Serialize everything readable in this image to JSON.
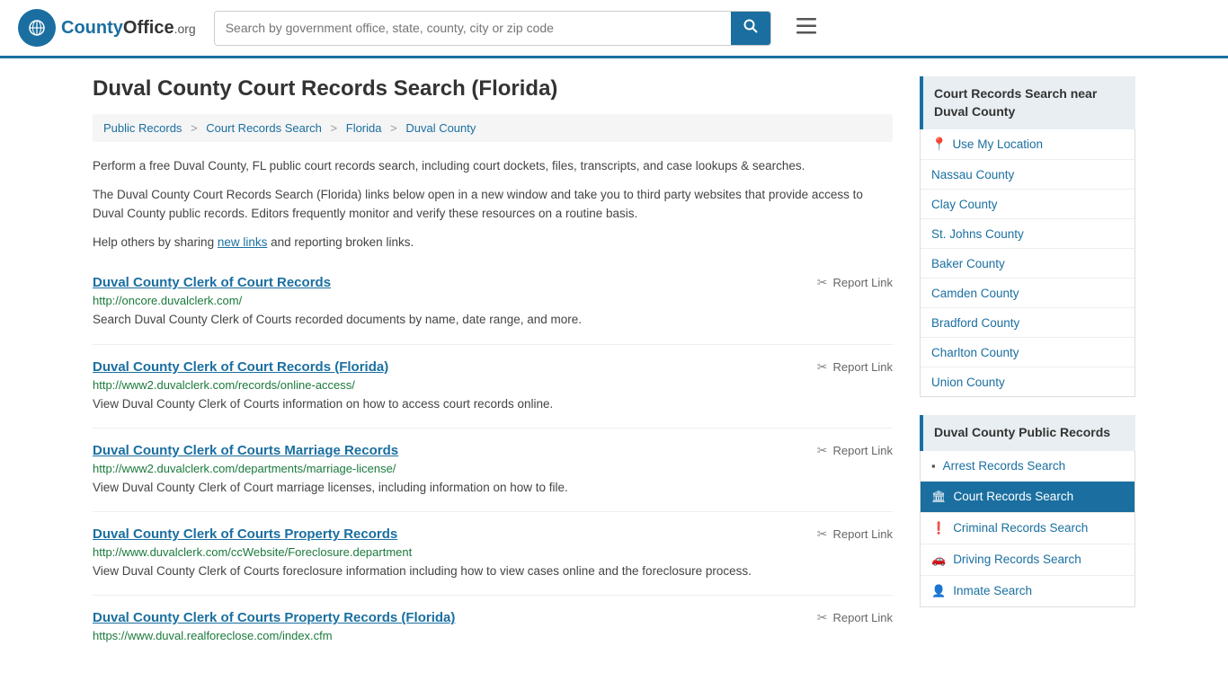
{
  "header": {
    "logo_text": "CountyOffice",
    "logo_tld": ".org",
    "search_placeholder": "Search by government office, state, county, city or zip code",
    "search_value": ""
  },
  "page": {
    "title": "Duval County Court Records Search (Florida)",
    "breadcrumbs": [
      {
        "label": "Public Records",
        "href": "#"
      },
      {
        "label": "Court Records Search",
        "href": "#"
      },
      {
        "label": "Florida",
        "href": "#"
      },
      {
        "label": "Duval County",
        "href": "#"
      }
    ],
    "description1": "Perform a free Duval County, FL public court records search, including court dockets, files, transcripts, and case lookups & searches.",
    "description2": "The Duval County Court Records Search (Florida) links below open in a new window and take you to third party websites that provide access to Duval County public records. Editors frequently monitor and verify these resources on a routine basis.",
    "description3_pre": "Help others by sharing ",
    "description3_link": "new links",
    "description3_post": " and reporting broken links."
  },
  "results": [
    {
      "title": "Duval County Clerk of Court Records",
      "url": "http://oncore.duvalclerk.com/",
      "description": "Search Duval County Clerk of Courts recorded documents by name, date range, and more.",
      "report_label": "Report Link"
    },
    {
      "title": "Duval County Clerk of Court Records (Florida)",
      "url": "http://www2.duvalclerk.com/records/online-access/",
      "description": "View Duval County Clerk of Courts information on how to access court records online.",
      "report_label": "Report Link"
    },
    {
      "title": "Duval County Clerk of Courts Marriage Records",
      "url": "http://www2.duvalclerk.com/departments/marriage-license/",
      "description": "View Duval County Clerk of Court marriage licenses, including information on how to file.",
      "report_label": "Report Link"
    },
    {
      "title": "Duval County Clerk of Courts Property Records",
      "url": "http://www.duvalclerk.com/ccWebsite/Foreclosure.department",
      "description": "View Duval County Clerk of Courts foreclosure information including how to view cases online and the foreclosure process.",
      "report_label": "Report Link"
    },
    {
      "title": "Duval County Clerk of Courts Property Records (Florida)",
      "url": "https://www.duval.realforeclose.com/index.cfm",
      "description": "",
      "report_label": "Report Link"
    }
  ],
  "sidebar": {
    "nearby_title": "Court Records Search near Duval County",
    "use_my_location": "Use My Location",
    "nearby_counties": [
      {
        "label": "Nassau County"
      },
      {
        "label": "Clay County"
      },
      {
        "label": "St. Johns County"
      },
      {
        "label": "Baker County"
      },
      {
        "label": "Camden County"
      },
      {
        "label": "Bradford County"
      },
      {
        "label": "Charlton County"
      },
      {
        "label": "Union County"
      }
    ],
    "public_records_title": "Duval County Public Records",
    "public_records_items": [
      {
        "label": "Arrest Records Search",
        "icon": "▪",
        "active": false
      },
      {
        "label": "Court Records Search",
        "icon": "🏛",
        "active": true
      },
      {
        "label": "Criminal Records Search",
        "icon": "❗",
        "active": false
      },
      {
        "label": "Driving Records Search",
        "icon": "🚗",
        "active": false
      },
      {
        "label": "Inmate Search",
        "icon": "👤",
        "active": false
      }
    ]
  }
}
